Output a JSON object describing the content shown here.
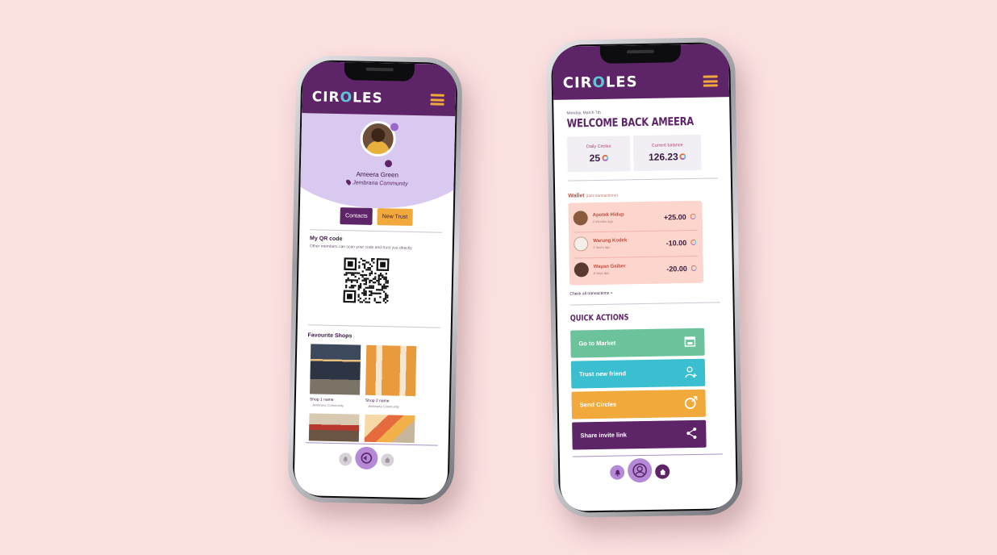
{
  "brand": {
    "logo_prefix": "CIR",
    "logo_o": "O",
    "logo_suffix": "LES",
    "primary": "#5d2468",
    "accent": "#f2a93b",
    "teal": "#5fc5d6"
  },
  "profile_screen": {
    "name": "Ameera Green",
    "community": "Jembrana Community",
    "buttons": {
      "contacts": "Contacts",
      "new_trust": "New Trust"
    },
    "qr": {
      "title": "My QR code",
      "subtitle": "Other members can scan your code and trust you directly"
    },
    "favourites": {
      "title": "Favourite Shops",
      "shops": [
        {
          "name": "Shop 1 name",
          "location": "Jembrana Community"
        },
        {
          "name": "Shop 2 name",
          "location": "Jembrana Community"
        }
      ]
    },
    "nav": [
      "bell-icon",
      "exchange-icon",
      "home-icon"
    ]
  },
  "home_screen": {
    "date": "Monday, March 7th",
    "welcome": "WELCOME BACK AMEERA",
    "cards": [
      {
        "label": "Daily Circles",
        "value": "25"
      },
      {
        "label": "Current balance",
        "value": "126.23"
      }
    ],
    "wallet": {
      "title": "Wallet",
      "subtitle": "(last transactions)",
      "transactions": [
        {
          "name": "Apotek Hidup",
          "time": "2 minutes ago",
          "amount": "+25.00"
        },
        {
          "name": "Warung Kodek",
          "time": "2 hours ago",
          "amount": "-10.00"
        },
        {
          "name": "Wayan Gaiber",
          "time": "6 days ago",
          "amount": "-20.00"
        }
      ],
      "check_all": "Check all transactions >"
    },
    "quick_actions": {
      "title": "QUICK ACTIONS",
      "items": [
        {
          "label": "Go to Market",
          "color": "#6cc39b",
          "icon": "store-icon"
        },
        {
          "label": "Trust new friend",
          "color": "#3bbfd0",
          "icon": "add-user-icon"
        },
        {
          "label": "Send Circles",
          "color": "#f2a93b",
          "icon": "send-circles-icon"
        },
        {
          "label": "Share invite link",
          "color": "#5d2468",
          "icon": "share-icon"
        }
      ]
    },
    "nav": [
      "bell-icon",
      "profile-icon",
      "home-icon"
    ]
  }
}
